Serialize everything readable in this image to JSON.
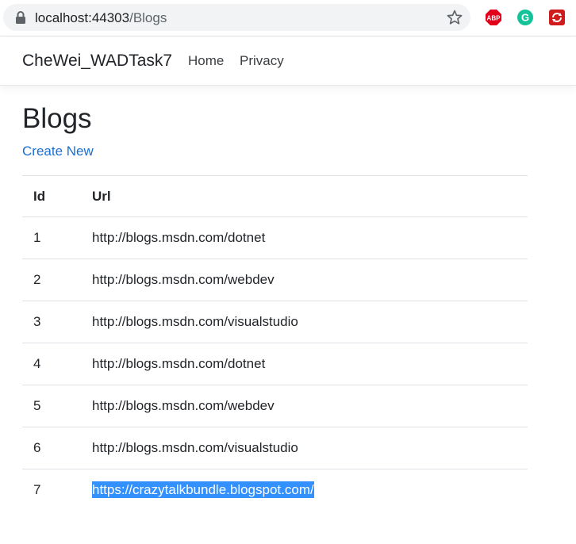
{
  "browser": {
    "url_host": "localhost:44303",
    "url_path": "/Blogs",
    "lock_icon": "lock-icon",
    "bookmark_icon": "star-icon",
    "extensions": [
      {
        "name": "abp-extension-icon",
        "label": "ABP",
        "color": "#e2001a"
      },
      {
        "name": "grammarly-extension-icon",
        "label": "G",
        "color": "#15c39a"
      },
      {
        "name": "red-extension-icon",
        "color": "#d01c1c"
      }
    ]
  },
  "navbar": {
    "brand": "CheWei_WADTask7",
    "links": [
      "Home",
      "Privacy"
    ]
  },
  "page": {
    "title": "Blogs",
    "create_new": "Create New"
  },
  "table": {
    "headers": [
      "Id",
      "Url"
    ],
    "rows": [
      {
        "id": "1",
        "url": "http://blogs.msdn.com/dotnet"
      },
      {
        "id": "2",
        "url": "http://blogs.msdn.com/webdev"
      },
      {
        "id": "3",
        "url": "http://blogs.msdn.com/visualstudio"
      },
      {
        "id": "4",
        "url": "http://blogs.msdn.com/dotnet"
      },
      {
        "id": "5",
        "url": "http://blogs.msdn.com/webdev"
      },
      {
        "id": "6",
        "url": "http://blogs.msdn.com/visualstudio"
      },
      {
        "id": "7",
        "url": "https://crazytalkbundle.blogspot.com/",
        "selected": true
      }
    ]
  },
  "colors": {
    "link": "#1a6fd1",
    "selection": "#3390ff"
  }
}
